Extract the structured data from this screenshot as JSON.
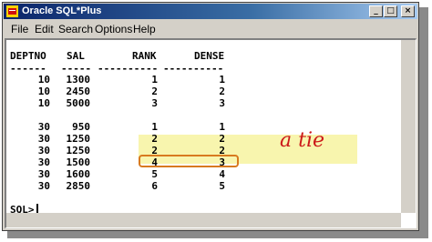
{
  "window": {
    "title": "Oracle SQL*Plus",
    "controls": {
      "minimize": "_",
      "maximize": "□",
      "close": "×"
    }
  },
  "menu": [
    "File",
    "Edit",
    "Search",
    "Options",
    "Help"
  ],
  "columns": {
    "headers": [
      "DEPTNO",
      "SAL",
      "RANK",
      "DENSE"
    ],
    "separators": [
      "------",
      "-----",
      "----------",
      "----------"
    ]
  },
  "rows": [
    {
      "deptno": "10",
      "sal": "1300",
      "rank": "1",
      "dense": "1"
    },
    {
      "deptno": "10",
      "sal": "2450",
      "rank": "2",
      "dense": "2"
    },
    {
      "deptno": "10",
      "sal": "5000",
      "rank": "3",
      "dense": "3"
    },
    {
      "deptno": "30",
      "sal": "950",
      "rank": "1",
      "dense": "1"
    },
    {
      "deptno": "30",
      "sal": "1250",
      "rank": "2",
      "dense": "2"
    },
    {
      "deptno": "30",
      "sal": "1250",
      "rank": "2",
      "dense": "2"
    },
    {
      "deptno": "30",
      "sal": "1500",
      "rank": "4",
      "dense": "3"
    },
    {
      "deptno": "30",
      "sal": "1600",
      "rank": "5",
      "dense": "4"
    },
    {
      "deptno": "30",
      "sal": "2850",
      "rank": "6",
      "dense": "5"
    }
  ],
  "annotation": "a tie",
  "prompt": "SQL>",
  "colors": {
    "highlight": "#f7f3a0",
    "ring": "#d87a1f",
    "annotation": "#cc1a1a",
    "titlebar": "#0a246a"
  }
}
